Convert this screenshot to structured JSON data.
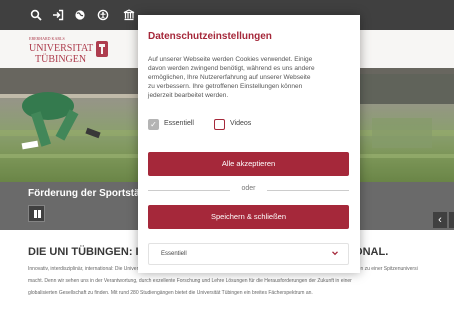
{
  "top_bar": {
    "icons": [
      "search-icon",
      "login-icon",
      "globe-icon",
      "accessibility-icon",
      "library-icon"
    ]
  },
  "header": {
    "logo_name": "Eberhard Karls Universität Tübingen"
  },
  "hero": {
    "caption": "Förderung der Sportstätte",
    "pause_icon": "pause-icon",
    "prev_icon": "chevron-left-icon",
    "prev_glyph": "‹"
  },
  "main": {
    "headline_left": "DIE UNI TÜBINGEN: I",
    "headline_right": "IONAL.",
    "body_left": [
      "Innovativ, interdisziplinär, international: Die Universität Tübingen verbindet exzellente Forschung und Lehre",
      "macht. Denn wir sehen uns in der Verantwortung, durch exzellente Forschung und Lehre Lösungen für die Herausforderungen der Zukunft in einer",
      "globalisierten Gesellschaft zu finden. Mit rund 280 Studiengängen bietet die Universität Tübingen ein breites Fächerspektrum an."
    ],
    "body_right": [
      "ingen zu einer Spitzenuniversi",
      ""
    ]
  },
  "cookie_modal": {
    "title": "Datenschutzeinstellungen",
    "text_lines": [
      "Auf unserer Webseite werden Cookies verwendet. Einige",
      "davon werden zwingend benötigt, während es uns andere",
      "ermöglichen, Ihre Nutzererfahrung auf unserer Webseite",
      "zu verbessern. Ihre getroffenen Einstellungen können",
      "jederzeit bearbeitet werden."
    ],
    "checkbox_essential": {
      "label": "Essentiell",
      "checked": true
    },
    "checkbox_videos": {
      "label": "Videos",
      "checked": false
    },
    "accept_all_label": "Alle akzeptieren",
    "or_label": "oder",
    "save_close_label": "Speichern & schließen",
    "select_value": "Essentiell",
    "colors": {
      "accent": "#a5283a",
      "checkbox_disabled": "#b4b4b4"
    }
  }
}
